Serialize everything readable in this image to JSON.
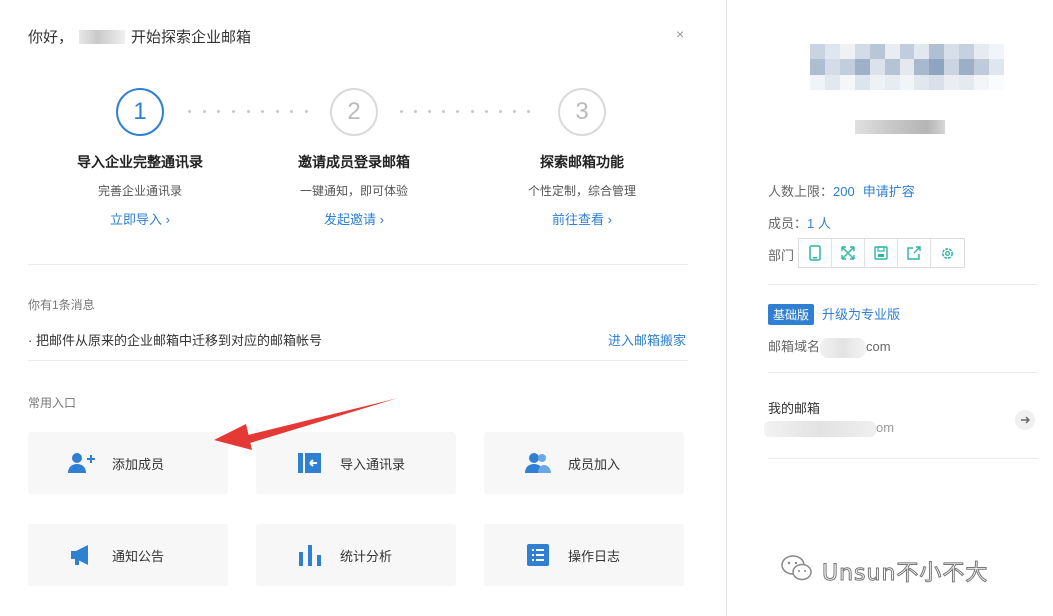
{
  "greeting": {
    "prefix": "你好，",
    "suffix": "开始探索企业邮箱"
  },
  "close_symbol": "×",
  "steps": [
    {
      "number": "1",
      "title": "导入企业完整通讯录",
      "desc": "完善企业通讯录",
      "link": "立即导入 ›",
      "active": true
    },
    {
      "number": "2",
      "title": "邀请成员登录邮箱",
      "desc": "一键通知，即可体验",
      "link": "发起邀请 ›",
      "active": false
    },
    {
      "number": "3",
      "title": "探索邮箱功能",
      "desc": "个性定制，综合管理",
      "link": "前往查看 ›",
      "active": false
    }
  ],
  "messages": {
    "header": "你有1条消息",
    "text": "· 把邮件从原来的企业邮箱中迁移到对应的邮箱帐号",
    "link": "进入邮箱搬家"
  },
  "entries": {
    "header": "常用入口",
    "tiles": [
      {
        "label": "添加成员",
        "icon": "add-user-icon"
      },
      {
        "label": "导入通讯录",
        "icon": "import-contacts-icon"
      },
      {
        "label": "成员加入",
        "icon": "members-join-icon"
      },
      {
        "label": "通知公告",
        "icon": "megaphone-icon"
      },
      {
        "label": "统计分析",
        "icon": "bar-chart-icon"
      },
      {
        "label": "操作日志",
        "icon": "log-list-icon"
      }
    ]
  },
  "sidebar": {
    "limit_label": "人数上限：",
    "limit_value": "200",
    "limit_link": "申请扩容",
    "members_label": "成员：",
    "members_value": "1 人",
    "dept_label": "部门",
    "dept_icons": [
      "mobile-icon",
      "expand-icon",
      "save-icon",
      "share-icon",
      "settings-icon"
    ],
    "edition_badge": "基础版",
    "upgrade_link": "升级为专业版",
    "domain_label": "邮箱域名",
    "domain_suffix": "com",
    "mybox_label": "我的邮箱",
    "mybox_suffix": "om"
  },
  "watermark": {
    "text": "Unsun不小不大",
    "icon": "wechat-icon"
  },
  "colors": {
    "accent": "#2f7fd3",
    "icon_green": "#2bb5a0",
    "arrow_red": "#e53935"
  }
}
